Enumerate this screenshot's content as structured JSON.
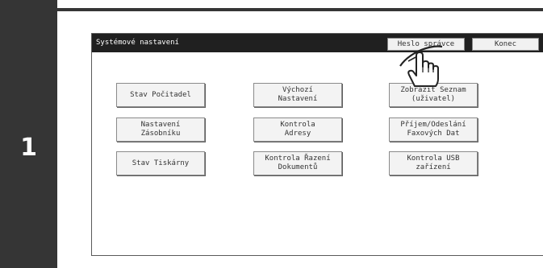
{
  "step": "1",
  "screen": {
    "title": "Systémové nastavení",
    "admin_password_button": "Heslo správce",
    "exit_button": "Konec"
  },
  "buttons": [
    {
      "lines": [
        "Stav Počitadel",
        ""
      ]
    },
    {
      "lines": [
        "Výchozí",
        "Nastavení"
      ]
    },
    {
      "lines": [
        "Zobrazit Seznam",
        "(uživatel)"
      ]
    },
    {
      "lines": [
        "Nastavení",
        "Zásobníku"
      ]
    },
    {
      "lines": [
        "Kontrola",
        "Adresy"
      ]
    },
    {
      "lines": [
        "Příjem/Odeslání",
        "Faxových Dat"
      ]
    },
    {
      "lines": [
        "Stav Tiskárny",
        ""
      ]
    },
    {
      "lines": [
        "Kontrola Řazení",
        "Dokumentů"
      ]
    },
    {
      "lines": [
        "Kontrola USB",
        "zařízení"
      ]
    }
  ],
  "pointer_icon": "hand-pointer-icon"
}
